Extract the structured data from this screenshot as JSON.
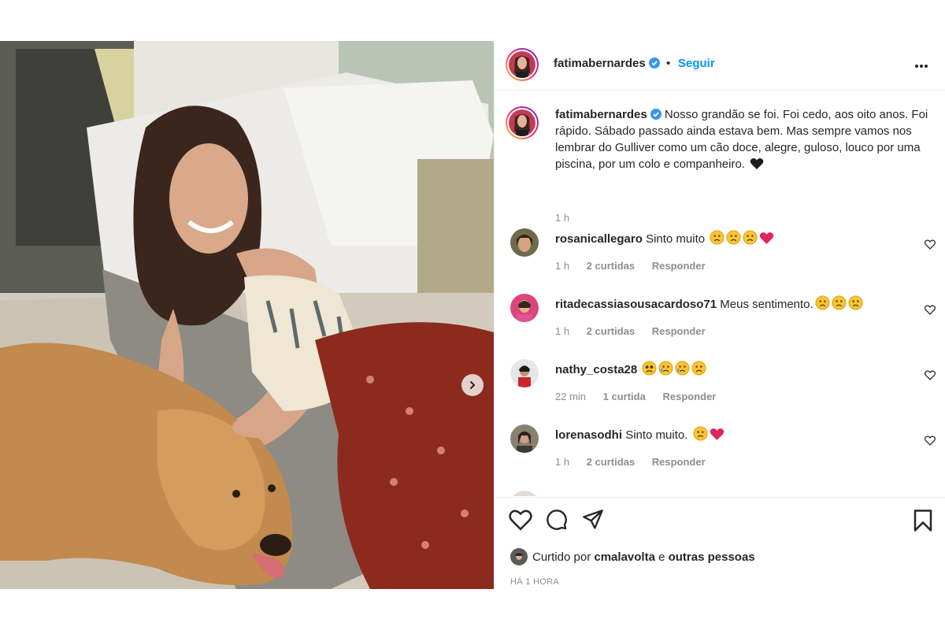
{
  "post": {
    "author": "fatimabernardes",
    "follow_label": "Seguir",
    "separator": "•",
    "caption": "Nosso grandão se foi. Foi cedo, aos oito anos. Foi rápido. Sábado passado ainda estava bem. Mas sempre vamos nos lembrar do Gulliver como um cão doce, alegre, guloso, louco por uma piscina, por um colo e companheiro.",
    "caption_emoji": "black-heart",
    "caption_time": "1 h"
  },
  "comments": [
    {
      "user": "rosanicallegaro",
      "text": "Sinto muito",
      "emojis": [
        "sad-face",
        "sad-face",
        "sad-face",
        "red-heart"
      ],
      "time": "1 h",
      "likes": "2 curtidas",
      "reply": "Responder"
    },
    {
      "user": "ritadecassiasousacardoso71",
      "text": "Meus sentimento.",
      "emojis": [
        "sad-face",
        "sad-face",
        "sad-face"
      ],
      "time": "1 h",
      "likes": "2 curtidas",
      "reply": "Responder"
    },
    {
      "user": "nathy_costa28",
      "text": "",
      "emojis": [
        "frown-face",
        "crying-face",
        "crying-face",
        "sad-face"
      ],
      "time": "22 min",
      "likes": "1 curtida",
      "reply": "Responder"
    },
    {
      "user": "lorenasodhi",
      "text": "Sinto muito.",
      "emojis": [
        "sad-face",
        "red-heart"
      ],
      "time": "1 h",
      "likes": "2 curtidas",
      "reply": "Responder"
    }
  ],
  "footer": {
    "liked_prefix": "Curtido por",
    "liked_user": "cmalavolta",
    "liked_and": "e",
    "liked_others": "outras pessoas",
    "timestamp": "HÁ 1 HORA"
  },
  "colors": {
    "link_blue": "#0095f6",
    "text_dark": "#262626",
    "text_gray": "#8e8e8e",
    "verified_blue": "#3897f0",
    "heart_red": "#ed4956"
  },
  "icons": [
    "verified-badge-icon",
    "more-options-icon",
    "heart-icon",
    "comment-icon",
    "share-icon",
    "bookmark-icon",
    "next-arrow-icon"
  ]
}
